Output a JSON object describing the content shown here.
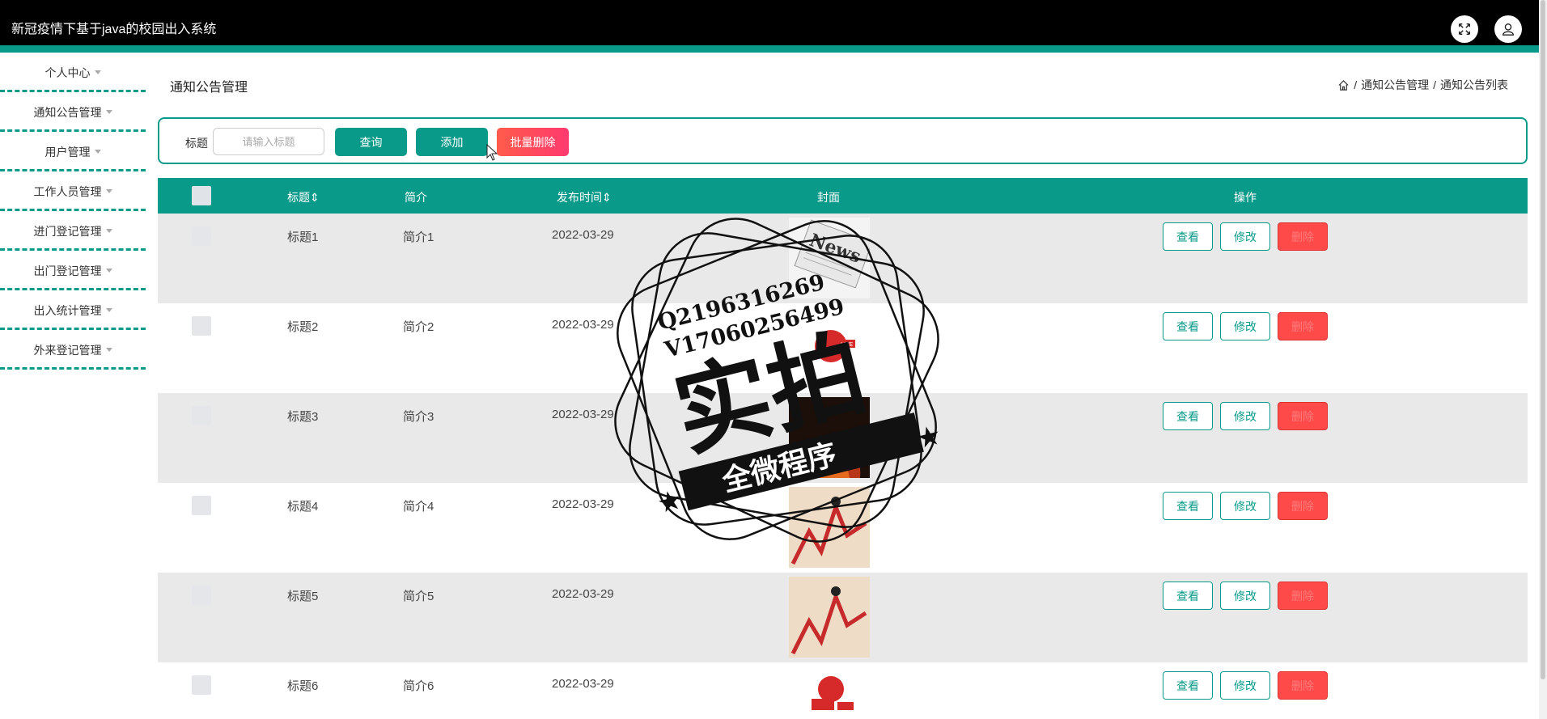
{
  "header": {
    "title": "新冠疫情下基于java的校园出入系统",
    "fullscreen_icon": "fullscreen-icon",
    "user_icon": "user-icon"
  },
  "sidebar": {
    "items": [
      {
        "label": "个人中心"
      },
      {
        "label": "通知公告管理"
      },
      {
        "label": "用户管理"
      },
      {
        "label": "工作人员管理"
      },
      {
        "label": "进门登记管理"
      },
      {
        "label": "出门登记管理"
      },
      {
        "label": "出入统计管理"
      },
      {
        "label": "外来登记管理"
      }
    ]
  },
  "page": {
    "title": "通知公告管理",
    "breadcrumb": [
      "通知公告管理",
      "通知公告列表"
    ],
    "breadcrumb_sep": "/"
  },
  "search": {
    "label": "标题",
    "placeholder": "请输入标题",
    "query_button": "查询",
    "add_button": "添加",
    "batch_delete_button": "批量删除"
  },
  "table": {
    "columns": {
      "title": "标题",
      "summary": "简介",
      "publish_time": "发布时间",
      "cover": "封面",
      "actions": "操作"
    },
    "sort_icon": "sort-icon",
    "action_labels": {
      "view": "查看",
      "edit": "修改",
      "delete": "删除"
    },
    "rows": [
      {
        "title": "标题1",
        "summary": "简介1",
        "date": "2022-03-29",
        "cover": "news-newspaper"
      },
      {
        "title": "标题2",
        "summary": "简介2",
        "date": "2022-03-29",
        "cover": "live-microphone"
      },
      {
        "title": "标题3",
        "summary": "简介3",
        "date": "2022-03-29",
        "cover": "fire"
      },
      {
        "title": "标题4",
        "summary": "简介4",
        "date": "2022-03-29",
        "cover": "falling-chart"
      },
      {
        "title": "标题5",
        "summary": "简介5",
        "date": "2022-03-29",
        "cover": "falling-chart"
      },
      {
        "title": "标题6",
        "summary": "简介6",
        "date": "2022-03-29",
        "cover": "live-microphone"
      }
    ]
  },
  "watermark": {
    "line1": "Q2196316269",
    "line2": "V17060256499",
    "main": "实拍",
    "ribbon": "全微程序"
  },
  "colors": {
    "accent": "#0a9a8a",
    "danger": "#ff4a4a",
    "header": "#000000"
  }
}
